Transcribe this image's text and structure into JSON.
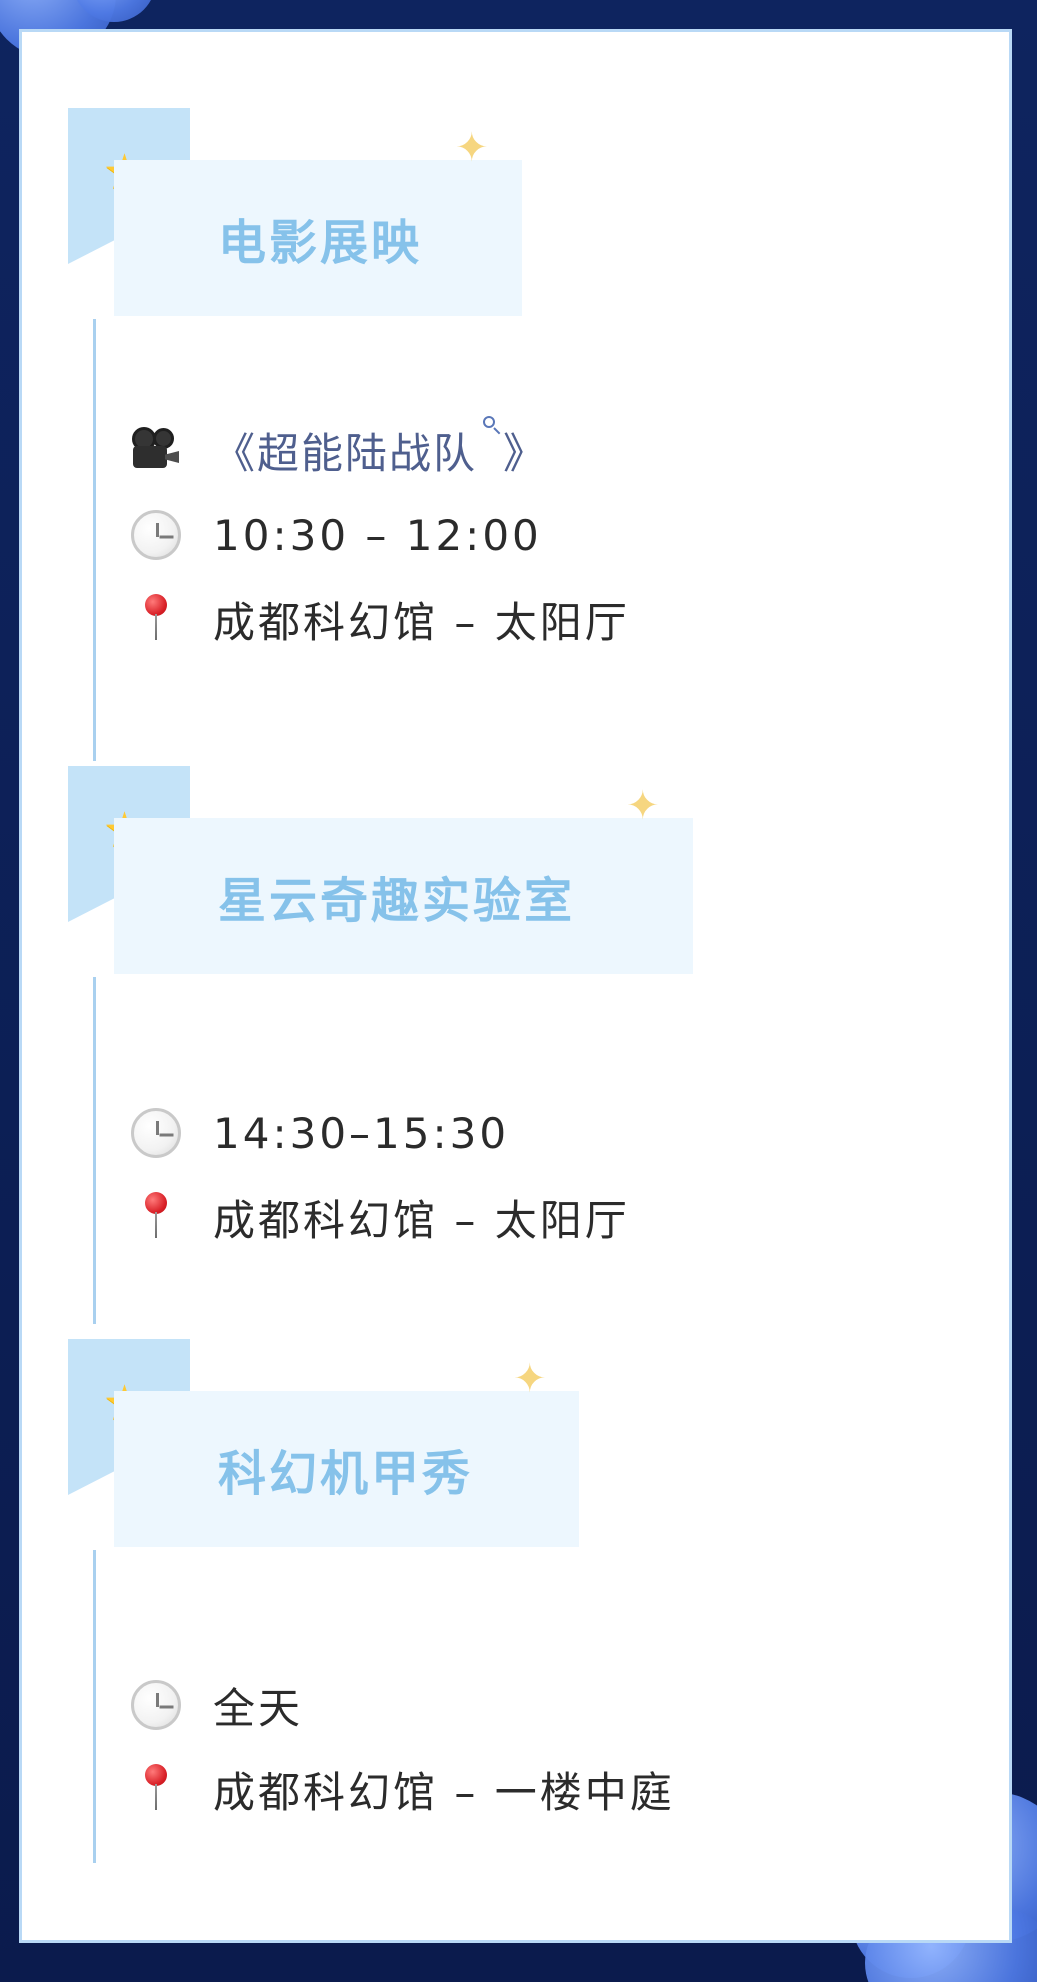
{
  "sections": [
    {
      "title": "电影展映",
      "movie": {
        "left_mark": "《",
        "name": "超能陆战队",
        "right_mark": "》"
      },
      "time": "10:30 – 12:00",
      "location": "成都科幻馆 – 太阳厅"
    },
    {
      "title": "星云奇趣实验室",
      "time": "14:30–15:30",
      "location": "成都科幻馆 – 太阳厅"
    },
    {
      "title": "科幻机甲秀",
      "time": "全天",
      "location": "成都科幻馆 – 一楼中庭"
    }
  ],
  "colors": {
    "accent": "#86c2ea",
    "ribbon": "#c4e3f8",
    "title_bg": "#edf7fe",
    "timeline": "#a9d0ef",
    "text": "#2b2b2b",
    "movie_text": "#4f5f8e"
  },
  "icons": [
    "star-icon",
    "sparkle-icon",
    "movie-camera-icon",
    "search-icon",
    "clock-icon",
    "location-pin-icon"
  ]
}
